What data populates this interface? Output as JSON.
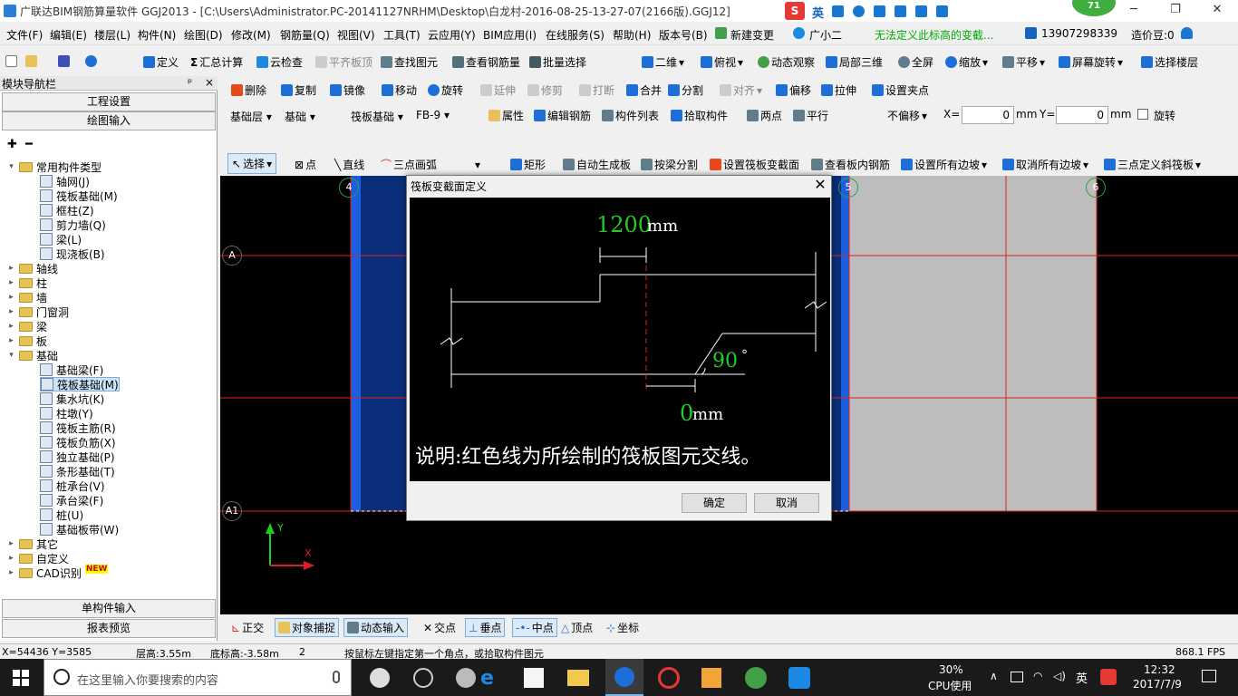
{
  "window": {
    "title": "广联达BIM钢筋算量软件 GGJ2013 - [C:\\Users\\Administrator.PC-20141127NRHM\\Desktop\\白龙村-2016-08-25-13-27-07(2166版).GGJ12]",
    "ime_label": "英",
    "badge": "71",
    "min": "─",
    "max": "❐",
    "close": "✕"
  },
  "menu": {
    "items": [
      "文件(F)",
      "编辑(E)",
      "楼层(L)",
      "构件(N)",
      "绘图(D)",
      "修改(M)",
      "钢筋量(Q)",
      "视图(V)",
      "工具(T)",
      "云应用(Y)",
      "BIM应用(I)",
      "在线服务(S)",
      "帮助(H)",
      "版本号(B)",
      "新建变更",
      "广小二"
    ],
    "notice": "无法定义此标高的变截...",
    "phone": "13907298339",
    "cost": "造价豆:0"
  },
  "toolbar1": {
    "items": [
      "定义",
      "汇总计算",
      "云检查",
      "平齐板顶",
      "查找图元",
      "查看钢筋量",
      "批量选择",
      "二维",
      "俯视",
      "动态观察",
      "局部三维",
      "全屏",
      "缩放",
      "平移",
      "屏幕旋转",
      "选择楼层"
    ]
  },
  "toolbar2": {
    "items": [
      "删除",
      "复制",
      "镜像",
      "移动",
      "旋转",
      "延伸",
      "修剪",
      "打断",
      "合并",
      "分割",
      "对齐",
      "偏移",
      "拉伸",
      "设置夹点"
    ]
  },
  "toolbar3": {
    "layer": "基础层",
    "category": "基础",
    "type": "筏板基础",
    "member": "FB-9",
    "items": [
      "属性",
      "编辑钢筋",
      "构件列表",
      "拾取构件",
      "两点",
      "平行"
    ],
    "offset": "不偏移",
    "x_label": "X=",
    "x_value": "0",
    "y_label": "Y=",
    "y_value": "0",
    "unit": "mm",
    "rotate": "旋转"
  },
  "toolbar4": {
    "items": [
      "选择",
      "点",
      "直线",
      "三点画弧",
      "矩形",
      "自动生成板",
      "按梁分割",
      "设置筏板变截面",
      "查看板内钢筋",
      "设置所有边坡",
      "取消所有边坡",
      "三点定义斜筏板"
    ]
  },
  "sidebar": {
    "title": "模块导航栏",
    "pin": "ᵖ",
    "close": "×",
    "btn_project": "工程设置",
    "btn_draw": "绘图输入",
    "btn_single": "单构件输入",
    "btn_report": "报表预览",
    "tree": [
      {
        "label": "常用构件类型",
        "level": 0,
        "kind": "folder",
        "open": true
      },
      {
        "label": "轴网(J)",
        "level": 1,
        "kind": "item"
      },
      {
        "label": "筏板基础(M)",
        "level": 1,
        "kind": "item"
      },
      {
        "label": "框柱(Z)",
        "level": 1,
        "kind": "item"
      },
      {
        "label": "剪力墙(Q)",
        "level": 1,
        "kind": "item"
      },
      {
        "label": "梁(L)",
        "level": 1,
        "kind": "item"
      },
      {
        "label": "现浇板(B)",
        "level": 1,
        "kind": "item"
      },
      {
        "label": "轴线",
        "level": 0,
        "kind": "folder"
      },
      {
        "label": "柱",
        "level": 0,
        "kind": "folder"
      },
      {
        "label": "墙",
        "level": 0,
        "kind": "folder"
      },
      {
        "label": "门窗洞",
        "level": 0,
        "kind": "folder"
      },
      {
        "label": "梁",
        "level": 0,
        "kind": "folder"
      },
      {
        "label": "板",
        "level": 0,
        "kind": "folder"
      },
      {
        "label": "基础",
        "level": 0,
        "kind": "folder",
        "open": true
      },
      {
        "label": "基础梁(F)",
        "level": 1,
        "kind": "item"
      },
      {
        "label": "筏板基础(M)",
        "level": 1,
        "kind": "item",
        "selected": true
      },
      {
        "label": "集水坑(K)",
        "level": 1,
        "kind": "item"
      },
      {
        "label": "柱墩(Y)",
        "level": 1,
        "kind": "item"
      },
      {
        "label": "筏板主筋(R)",
        "level": 1,
        "kind": "item"
      },
      {
        "label": "筏板负筋(X)",
        "level": 1,
        "kind": "item"
      },
      {
        "label": "独立基础(P)",
        "level": 1,
        "kind": "item"
      },
      {
        "label": "条形基础(T)",
        "level": 1,
        "kind": "item"
      },
      {
        "label": "桩承台(V)",
        "level": 1,
        "kind": "item"
      },
      {
        "label": "承台梁(F)",
        "level": 1,
        "kind": "item"
      },
      {
        "label": "桩(U)",
        "level": 1,
        "kind": "item"
      },
      {
        "label": "基础板带(W)",
        "level": 1,
        "kind": "item"
      },
      {
        "label": "其它",
        "level": 0,
        "kind": "folder"
      },
      {
        "label": "自定义",
        "level": 0,
        "kind": "folder"
      },
      {
        "label": "CAD识别",
        "level": 0,
        "kind": "folder",
        "badge": "NEW"
      }
    ]
  },
  "canvas": {
    "axis_labels": [
      "4",
      "5",
      "6",
      "A",
      "A1"
    ],
    "axis_x": "X",
    "axis_y": "Y"
  },
  "dialog": {
    "title": "筏板变截面定义",
    "dim_top": "1200",
    "unit": "mm",
    "angle": "90",
    "degree": "°",
    "dim_bottom": "0",
    "note": "说明:红色线为所绘制的筏板图元交线。",
    "ok": "确定",
    "cancel": "取消",
    "close": "✕"
  },
  "snapbar": {
    "items": [
      "正交",
      "对象捕捉",
      "动态输入",
      "交点",
      "垂点",
      "中点",
      "顶点",
      "坐标"
    ]
  },
  "status": {
    "coords": "X=54436 Y=3585",
    "floor_height": "层高:3.55m",
    "base_height": "底标高:-3.58m",
    "num": "2",
    "hint": "按鼠标左键指定第一个角点，或拾取构件图元",
    "fps": "868.1 FPS"
  },
  "taskbar": {
    "search": "在这里输入你要搜索的内容",
    "cpu_pct": "30%",
    "cpu_label": "CPU使用",
    "ime": "英",
    "time": "12:32",
    "date": "2017/7/9"
  },
  "colors": {
    "accent": "#1e6ed8",
    "blue_region": "#1a5fe0",
    "grey_region": "#bdbdbd",
    "grid_red": "#e02020",
    "green_text": "#22cc22"
  }
}
